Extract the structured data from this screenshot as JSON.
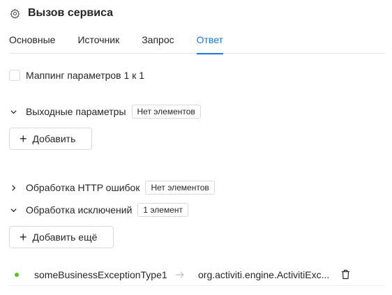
{
  "header": {
    "title": "Вызов сервиса",
    "icon": "gear-icon"
  },
  "tabs": [
    {
      "label": "Основные",
      "active": false
    },
    {
      "label": "Источник",
      "active": false
    },
    {
      "label": "Запрос",
      "active": false
    },
    {
      "label": "Ответ",
      "active": true
    }
  ],
  "accent_color": "#1677ff",
  "mapping": {
    "label": "Маппинг параметров 1 к 1",
    "checked": false
  },
  "output_params": {
    "label": "Выходные параметры",
    "badge": "Нет элементов",
    "expanded": true,
    "add_label": "Добавить"
  },
  "http_errors": {
    "label": "Обработка HTTP ошибок",
    "badge": "Нет элементов",
    "expanded": false
  },
  "exceptions": {
    "label": "Обработка исключений",
    "badge": "1 элемент",
    "expanded": true,
    "add_label": "Добавить ещё",
    "items": [
      {
        "name": "someBusinessExceptionType1",
        "class": "org.activiti.engine.ActivitiExc...",
        "status_color": "#52c41a"
      }
    ]
  }
}
